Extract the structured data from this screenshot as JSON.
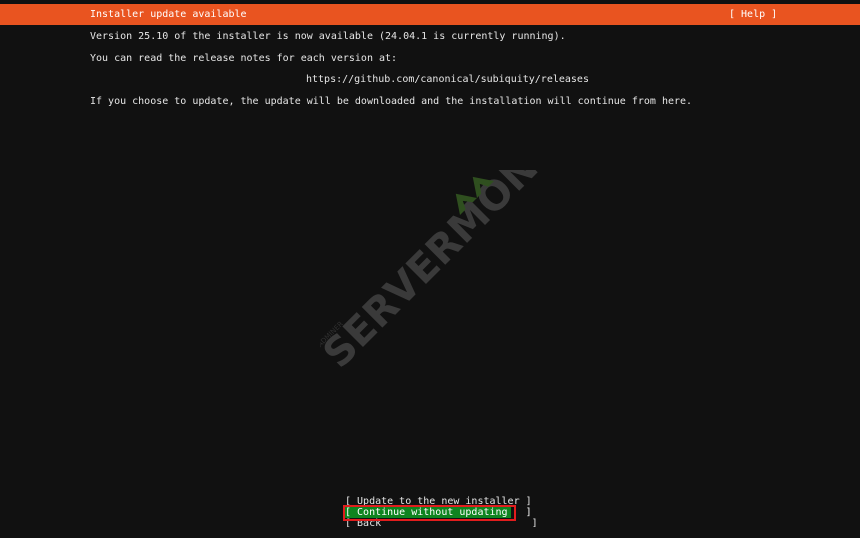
{
  "header": {
    "title": "Installer update available",
    "help_label": "[ Help ]",
    "background": "#e95420"
  },
  "body": {
    "line1": "Version 25.10 of the installer is now available (24.04.1 is currently running).",
    "line2": "You can read the release notes for each version at:",
    "url": "https://github.com/canonical/subiquity/releases",
    "line3": "If you choose to update, the update will be downloaded and the installation will continue from here."
  },
  "menu": {
    "items": [
      {
        "label": "[ Update to the new installer ]"
      },
      {
        "label": "[ Continue without updating   ]",
        "selected": true
      },
      {
        "label": "[ Back                         ]"
      }
    ],
    "selected_color": "#0e8420",
    "focus_ring_color": "#e11d1d"
  },
  "watermark": {
    "main": "SERVERMON",
    "sub": "ADMINER"
  }
}
